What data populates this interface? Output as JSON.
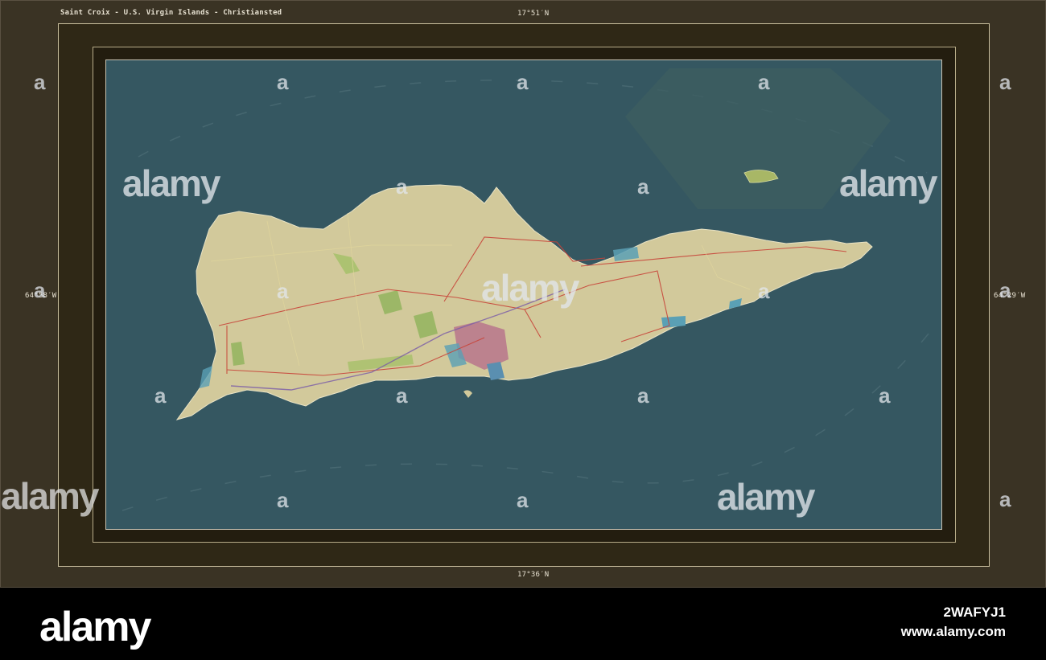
{
  "map": {
    "title": "Saint Croix - U.S. Virgin Islands - Christiansted",
    "lat_top": "17°51′N",
    "lat_bottom": "17°36′N",
    "lon_left": "64°58′W",
    "lon_right": "64°29′W",
    "colors": {
      "water": "#355761",
      "land": "#d2c99b",
      "roads": "#c8453a",
      "frame": "#3a3324"
    }
  },
  "watermark": {
    "word": "alamy",
    "small": "a"
  },
  "footer": {
    "brand": "alamy",
    "image_id": "2WAFYJ1",
    "site": "www.alamy.com"
  }
}
